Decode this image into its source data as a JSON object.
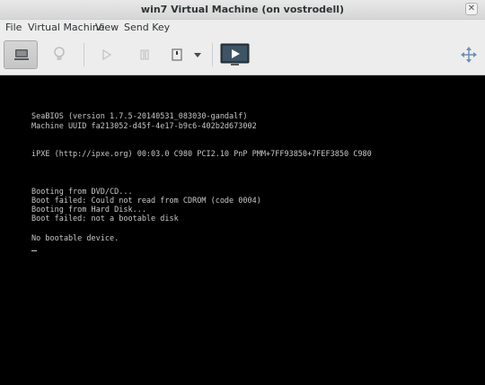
{
  "window": {
    "title": "win7 Virtual Machine (on vostrodell)",
    "close_label": "✕"
  },
  "menu": {
    "items": [
      "File",
      "Virtual Machine",
      "View",
      "Send Key"
    ]
  },
  "toolbar": {
    "buttons": [
      {
        "icon": "monitor-icon",
        "active": true
      },
      {
        "icon": "lightbulb-icon",
        "active": false
      },
      {
        "icon": "play-icon",
        "active": false
      },
      {
        "icon": "pause-icon",
        "active": false
      },
      {
        "icon": "power-icon",
        "active": false
      },
      {
        "icon": "dropdown-icon",
        "active": false
      },
      {
        "icon": "console-display-icon",
        "active": false
      },
      {
        "icon": "move-arrows-icon",
        "active": false
      }
    ]
  },
  "console": {
    "lines": [
      "SeaBIOS (version 1.7.5-20140531_083030-gandalf)",
      "Machine UUID fa213052-d45f-4e17-b9c6-402b2d673002",
      "iPXE (http://ipxe.org) 00:03.0 C980 PCI2.10 PnP PMM+7FF93850+7FEF3850 C980",
      "Booting from DVD/CD...",
      "Boot failed: Could not read from CDROM (code 0004)",
      "Booting from Hard Disk...",
      "Boot failed: not a bootable disk",
      "No bootable device."
    ]
  },
  "colors": {
    "console_bg": "#000000",
    "console_text": "#c8c8c8",
    "window_bg": "#ededed"
  }
}
